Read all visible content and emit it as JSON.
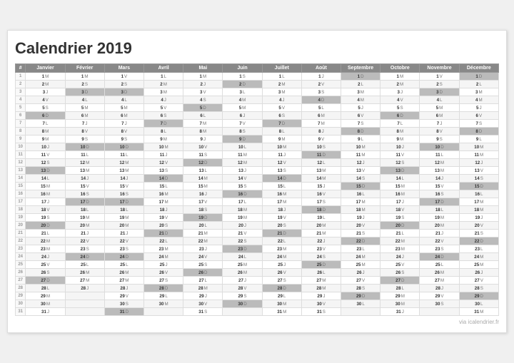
{
  "title": "Calendrier 2019",
  "footer": "via icalendrier.fr",
  "months": [
    "Janvier",
    "Février",
    "Mars",
    "Avril",
    "Mai",
    "Juin",
    "Juillet",
    "Août",
    "Septembre",
    "Octobre",
    "Novembre",
    "Décembre"
  ],
  "rows": [
    [
      [
        "1",
        "M"
      ],
      [
        "1",
        "M"
      ],
      [
        "1",
        "V"
      ],
      [
        "1",
        "L"
      ],
      [
        "1",
        "M"
      ],
      [
        "1",
        "S"
      ],
      [
        "1",
        "L"
      ],
      [
        "1",
        "J"
      ],
      [
        "1",
        "D"
      ],
      [
        "1",
        "M"
      ],
      [
        "1",
        "V"
      ],
      [
        "1",
        "D"
      ]
    ],
    [
      [
        "2",
        "M"
      ],
      [
        "2",
        "S"
      ],
      [
        "2",
        "S"
      ],
      [
        "2",
        "M"
      ],
      [
        "2",
        "J"
      ],
      [
        "2",
        "D"
      ],
      [
        "2",
        "M"
      ],
      [
        "2",
        "V"
      ],
      [
        "2",
        "L"
      ],
      [
        "2",
        "M"
      ],
      [
        "2",
        "S"
      ],
      [
        "2",
        "L"
      ]
    ],
    [
      [
        "3",
        "J"
      ],
      [
        "3",
        "D"
      ],
      [
        "3",
        "D"
      ],
      [
        "3",
        "M"
      ],
      [
        "3",
        "V"
      ],
      [
        "3",
        "L"
      ],
      [
        "3",
        "M"
      ],
      [
        "3",
        "S"
      ],
      [
        "3",
        "M"
      ],
      [
        "3",
        "J"
      ],
      [
        "3",
        "D"
      ],
      [
        "3",
        "M"
      ]
    ],
    [
      [
        "4",
        "V"
      ],
      [
        "4",
        "L"
      ],
      [
        "4",
        "L"
      ],
      [
        "4",
        "J"
      ],
      [
        "4",
        "S"
      ],
      [
        "4",
        "M"
      ],
      [
        "4",
        "J"
      ],
      [
        "4",
        "D"
      ],
      [
        "4",
        "M"
      ],
      [
        "4",
        "V"
      ],
      [
        "4",
        "L"
      ],
      [
        "4",
        "M"
      ]
    ],
    [
      [
        "5",
        "S"
      ],
      [
        "5",
        "M"
      ],
      [
        "5",
        "M"
      ],
      [
        "5",
        "V"
      ],
      [
        "5",
        "D"
      ],
      [
        "5",
        "M"
      ],
      [
        "5",
        "V"
      ],
      [
        "5",
        "L"
      ],
      [
        "5",
        "J"
      ],
      [
        "5",
        "S"
      ],
      [
        "5",
        "M"
      ],
      [
        "5",
        "J"
      ]
    ],
    [
      [
        "6",
        "D"
      ],
      [
        "6",
        "M"
      ],
      [
        "6",
        "M"
      ],
      [
        "6",
        "S"
      ],
      [
        "6",
        "L"
      ],
      [
        "6",
        "J"
      ],
      [
        "6",
        "S"
      ],
      [
        "6",
        "M"
      ],
      [
        "6",
        "V"
      ],
      [
        "6",
        "D"
      ],
      [
        "6",
        "M"
      ],
      [
        "6",
        "V"
      ]
    ],
    [
      [
        "7",
        "L"
      ],
      [
        "7",
        "J"
      ],
      [
        "7",
        "J"
      ],
      [
        "7",
        "D"
      ],
      [
        "7",
        "M"
      ],
      [
        "7",
        "V"
      ],
      [
        "7",
        "D"
      ],
      [
        "7",
        "M"
      ],
      [
        "7",
        "S"
      ],
      [
        "7",
        "L"
      ],
      [
        "7",
        "J"
      ],
      [
        "7",
        "S"
      ]
    ],
    [
      [
        "8",
        "M"
      ],
      [
        "8",
        "V"
      ],
      [
        "8",
        "V"
      ],
      [
        "8",
        "L"
      ],
      [
        "8",
        "M"
      ],
      [
        "8",
        "S"
      ],
      [
        "8",
        "L"
      ],
      [
        "8",
        "J"
      ],
      [
        "8",
        "D"
      ],
      [
        "8",
        "M"
      ],
      [
        "8",
        "V"
      ],
      [
        "8",
        "D"
      ]
    ],
    [
      [
        "9",
        "M"
      ],
      [
        "9",
        "S"
      ],
      [
        "9",
        "S"
      ],
      [
        "9",
        "M"
      ],
      [
        "9",
        "J"
      ],
      [
        "9",
        "D"
      ],
      [
        "9",
        "M"
      ],
      [
        "9",
        "V"
      ],
      [
        "9",
        "L"
      ],
      [
        "9",
        "M"
      ],
      [
        "9",
        "S"
      ],
      [
        "9",
        "L"
      ]
    ],
    [
      [
        "10",
        "J"
      ],
      [
        "10",
        "D"
      ],
      [
        "10",
        "D"
      ],
      [
        "10",
        "M"
      ],
      [
        "10",
        "V"
      ],
      [
        "10",
        "L"
      ],
      [
        "10",
        "M"
      ],
      [
        "10",
        "S"
      ],
      [
        "10",
        "M"
      ],
      [
        "10",
        "J"
      ],
      [
        "10",
        "D"
      ],
      [
        "10",
        "M"
      ]
    ],
    [
      [
        "11",
        "V"
      ],
      [
        "11",
        "L"
      ],
      [
        "11",
        "L"
      ],
      [
        "11",
        "J"
      ],
      [
        "11",
        "S"
      ],
      [
        "11",
        "M"
      ],
      [
        "11",
        "J"
      ],
      [
        "11",
        "D"
      ],
      [
        "11",
        "M"
      ],
      [
        "11",
        "V"
      ],
      [
        "11",
        "L"
      ],
      [
        "11",
        "M"
      ]
    ],
    [
      [
        "12",
        "S"
      ],
      [
        "12",
        "M"
      ],
      [
        "12",
        "M"
      ],
      [
        "12",
        "V"
      ],
      [
        "12",
        "D"
      ],
      [
        "12",
        "M"
      ],
      [
        "12",
        "V"
      ],
      [
        "12",
        "L"
      ],
      [
        "12",
        "J"
      ],
      [
        "12",
        "S"
      ],
      [
        "12",
        "M"
      ],
      [
        "12",
        "J"
      ]
    ],
    [
      [
        "13",
        "D"
      ],
      [
        "13",
        "M"
      ],
      [
        "13",
        "M"
      ],
      [
        "13",
        "S"
      ],
      [
        "13",
        "L"
      ],
      [
        "13",
        "J"
      ],
      [
        "13",
        "S"
      ],
      [
        "13",
        "M"
      ],
      [
        "13",
        "V"
      ],
      [
        "13",
        "D"
      ],
      [
        "13",
        "M"
      ],
      [
        "13",
        "V"
      ]
    ],
    [
      [
        "14",
        "L"
      ],
      [
        "14",
        "J"
      ],
      [
        "14",
        "J"
      ],
      [
        "14",
        "D"
      ],
      [
        "14",
        "M"
      ],
      [
        "14",
        "V"
      ],
      [
        "14",
        "D"
      ],
      [
        "14",
        "M"
      ],
      [
        "14",
        "S"
      ],
      [
        "14",
        "L"
      ],
      [
        "14",
        "J"
      ],
      [
        "14",
        "S"
      ]
    ],
    [
      [
        "15",
        "M"
      ],
      [
        "15",
        "V"
      ],
      [
        "15",
        "V"
      ],
      [
        "15",
        "L"
      ],
      [
        "15",
        "M"
      ],
      [
        "15",
        "S"
      ],
      [
        "15",
        "L"
      ],
      [
        "15",
        "J"
      ],
      [
        "15",
        "D"
      ],
      [
        "15",
        "M"
      ],
      [
        "15",
        "V"
      ],
      [
        "15",
        "D"
      ]
    ],
    [
      [
        "16",
        "M"
      ],
      [
        "16",
        "S"
      ],
      [
        "16",
        "S"
      ],
      [
        "16",
        "M"
      ],
      [
        "16",
        "J"
      ],
      [
        "16",
        "D"
      ],
      [
        "16",
        "M"
      ],
      [
        "16",
        "V"
      ],
      [
        "16",
        "L"
      ],
      [
        "16",
        "M"
      ],
      [
        "16",
        "S"
      ],
      [
        "16",
        "L"
      ]
    ],
    [
      [
        "17",
        "J"
      ],
      [
        "17",
        "D"
      ],
      [
        "17",
        "D"
      ],
      [
        "17",
        "M"
      ],
      [
        "17",
        "V"
      ],
      [
        "17",
        "L"
      ],
      [
        "17",
        "M"
      ],
      [
        "17",
        "S"
      ],
      [
        "17",
        "M"
      ],
      [
        "17",
        "J"
      ],
      [
        "17",
        "D"
      ],
      [
        "17",
        "M"
      ]
    ],
    [
      [
        "18",
        "V"
      ],
      [
        "18",
        "L"
      ],
      [
        "18",
        "L"
      ],
      [
        "18",
        "J"
      ],
      [
        "18",
        "S"
      ],
      [
        "18",
        "M"
      ],
      [
        "18",
        "J"
      ],
      [
        "18",
        "D"
      ],
      [
        "18",
        "M"
      ],
      [
        "18",
        "V"
      ],
      [
        "18",
        "L"
      ],
      [
        "18",
        "M"
      ]
    ],
    [
      [
        "19",
        "S"
      ],
      [
        "19",
        "M"
      ],
      [
        "19",
        "M"
      ],
      [
        "19",
        "V"
      ],
      [
        "19",
        "D"
      ],
      [
        "19",
        "M"
      ],
      [
        "19",
        "V"
      ],
      [
        "19",
        "L"
      ],
      [
        "19",
        "J"
      ],
      [
        "19",
        "S"
      ],
      [
        "19",
        "M"
      ],
      [
        "19",
        "J"
      ]
    ],
    [
      [
        "20",
        "D"
      ],
      [
        "20",
        "M"
      ],
      [
        "20",
        "M"
      ],
      [
        "20",
        "S"
      ],
      [
        "20",
        "L"
      ],
      [
        "20",
        "J"
      ],
      [
        "20",
        "S"
      ],
      [
        "20",
        "M"
      ],
      [
        "20",
        "V"
      ],
      [
        "20",
        "D"
      ],
      [
        "20",
        "M"
      ],
      [
        "20",
        "V"
      ]
    ],
    [
      [
        "21",
        "L"
      ],
      [
        "21",
        "J"
      ],
      [
        "21",
        "J"
      ],
      [
        "21",
        "D"
      ],
      [
        "21",
        "M"
      ],
      [
        "21",
        "V"
      ],
      [
        "21",
        "D"
      ],
      [
        "21",
        "M"
      ],
      [
        "21",
        "S"
      ],
      [
        "21",
        "L"
      ],
      [
        "21",
        "J"
      ],
      [
        "21",
        "S"
      ]
    ],
    [
      [
        "22",
        "M"
      ],
      [
        "22",
        "V"
      ],
      [
        "22",
        "V"
      ],
      [
        "22",
        "L"
      ],
      [
        "22",
        "M"
      ],
      [
        "22",
        "S"
      ],
      [
        "22",
        "L"
      ],
      [
        "22",
        "J"
      ],
      [
        "22",
        "D"
      ],
      [
        "22",
        "M"
      ],
      [
        "22",
        "V"
      ],
      [
        "22",
        "D"
      ]
    ],
    [
      [
        "23",
        "M"
      ],
      [
        "23",
        "S"
      ],
      [
        "23",
        "S"
      ],
      [
        "23",
        "M"
      ],
      [
        "23",
        "J"
      ],
      [
        "23",
        "D"
      ],
      [
        "23",
        "M"
      ],
      [
        "23",
        "V"
      ],
      [
        "23",
        "L"
      ],
      [
        "23",
        "M"
      ],
      [
        "23",
        "S"
      ],
      [
        "23",
        "L"
      ]
    ],
    [
      [
        "24",
        "J"
      ],
      [
        "24",
        "D"
      ],
      [
        "24",
        "D"
      ],
      [
        "24",
        "M"
      ],
      [
        "24",
        "V"
      ],
      [
        "24",
        "L"
      ],
      [
        "24",
        "M"
      ],
      [
        "24",
        "S"
      ],
      [
        "24",
        "M"
      ],
      [
        "24",
        "J"
      ],
      [
        "24",
        "D"
      ],
      [
        "24",
        "M"
      ]
    ],
    [
      [
        "25",
        "V"
      ],
      [
        "25",
        "L"
      ],
      [
        "25",
        "L"
      ],
      [
        "25",
        "J"
      ],
      [
        "25",
        "S"
      ],
      [
        "25",
        "M"
      ],
      [
        "25",
        "J"
      ],
      [
        "25",
        "D"
      ],
      [
        "25",
        "M"
      ],
      [
        "25",
        "V"
      ],
      [
        "25",
        "L"
      ],
      [
        "25",
        "M"
      ]
    ],
    [
      [
        "26",
        "S"
      ],
      [
        "26",
        "M"
      ],
      [
        "26",
        "M"
      ],
      [
        "26",
        "V"
      ],
      [
        "26",
        "D"
      ],
      [
        "26",
        "M"
      ],
      [
        "26",
        "V"
      ],
      [
        "26",
        "L"
      ],
      [
        "26",
        "J"
      ],
      [
        "26",
        "S"
      ],
      [
        "26",
        "M"
      ],
      [
        "26",
        "J"
      ]
    ],
    [
      [
        "27",
        "D"
      ],
      [
        "27",
        "M"
      ],
      [
        "27",
        "M"
      ],
      [
        "27",
        "S"
      ],
      [
        "27",
        "L"
      ],
      [
        "27",
        "J"
      ],
      [
        "27",
        "S"
      ],
      [
        "27",
        "M"
      ],
      [
        "27",
        "V"
      ],
      [
        "27",
        "D"
      ],
      [
        "27",
        "M"
      ],
      [
        "27",
        "V"
      ]
    ],
    [
      [
        "28",
        "L"
      ],
      [
        "28",
        "J"
      ],
      [
        "28",
        "J"
      ],
      [
        "28",
        "D"
      ],
      [
        "28",
        "M"
      ],
      [
        "28",
        "V"
      ],
      [
        "28",
        "D"
      ],
      [
        "28",
        "M"
      ],
      [
        "28",
        "S"
      ],
      [
        "28",
        "L"
      ],
      [
        "28",
        "J"
      ],
      [
        "28",
        "S"
      ]
    ],
    [
      [
        "29",
        "M"
      ],
      [
        "",
        ""
      ],
      [
        "29",
        "V"
      ],
      [
        "29",
        "L"
      ],
      [
        "29",
        "J"
      ],
      [
        "29",
        "S"
      ],
      [
        "29",
        "L"
      ],
      [
        "29",
        "J"
      ],
      [
        "29",
        "D"
      ],
      [
        "29",
        "M"
      ],
      [
        "29",
        "V"
      ],
      [
        "29",
        "D"
      ]
    ],
    [
      [
        "30",
        "M"
      ],
      [
        "",
        ""
      ],
      [
        "30",
        "S"
      ],
      [
        "30",
        "M"
      ],
      [
        "30",
        "V"
      ],
      [
        "30",
        "D"
      ],
      [
        "30",
        "M"
      ],
      [
        "30",
        "V"
      ],
      [
        "30",
        "L"
      ],
      [
        "30",
        "M"
      ],
      [
        "30",
        "S"
      ],
      [
        "30",
        "L"
      ]
    ],
    [
      [
        "31",
        "J"
      ],
      [
        "",
        ""
      ],
      [
        "31",
        "D"
      ],
      [
        "",
        ""
      ],
      [
        "31",
        "S"
      ],
      [
        "",
        ""
      ],
      [
        "31",
        "M"
      ],
      [
        "31",
        "S"
      ],
      [
        "",
        ""
      ],
      [
        "31",
        "J"
      ],
      [
        "",
        ""
      ],
      [
        "31",
        "M"
      ]
    ]
  ],
  "special_days": {
    "sunday_rows": [
      2,
      5,
      12,
      19,
      26
    ],
    "holiday_cells": {
      "0-0": true,
      "1-4": true,
      "3-3": true,
      "4-0": true,
      "7-4": true,
      "10-3": true,
      "13-3": true,
      "14-5": true,
      "20-3": true,
      "25-5": true,
      "28-3": true
    }
  }
}
